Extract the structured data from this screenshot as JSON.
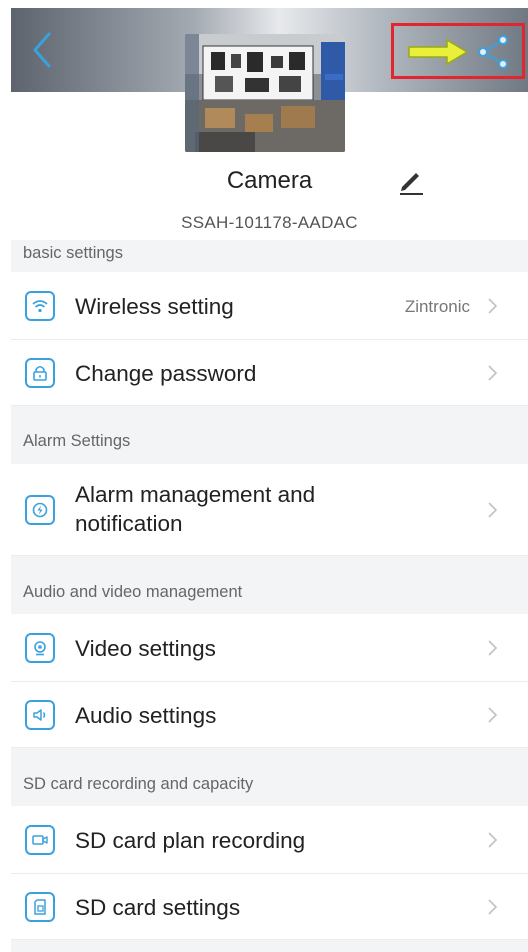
{
  "header": {
    "camera_name": "Camera",
    "camera_id": "SSAH-101178-AADAC"
  },
  "sections": {
    "basic": "basic settings",
    "alarm": "Alarm Settings",
    "av": "Audio and video management",
    "sd": "SD card recording and capacity"
  },
  "rows": {
    "wireless": {
      "label": "Wireless setting",
      "value": "Zintronic"
    },
    "password": {
      "label": "Change password"
    },
    "alarm_line1": "Alarm management and",
    "alarm_line2": "notification",
    "video": {
      "label": "Video settings"
    },
    "audio": {
      "label": "Audio settings"
    },
    "sd_plan": {
      "label": "SD card plan recording"
    },
    "sd_settings": {
      "label": "SD card settings"
    }
  },
  "colors": {
    "accent_blue": "#3aa1df",
    "highlight_red": "#e2262f",
    "arrow_yellow": "#e8f03a",
    "share_blue": "#3aa1df"
  },
  "icons": [
    "back-icon",
    "share-icon",
    "arrow-annotation-icon",
    "edit-icon",
    "wifi-icon",
    "lock-icon",
    "alarm-icon",
    "video-icon",
    "audio-icon",
    "sd-recording-icon",
    "sd-card-icon",
    "chevron-right-icon"
  ]
}
